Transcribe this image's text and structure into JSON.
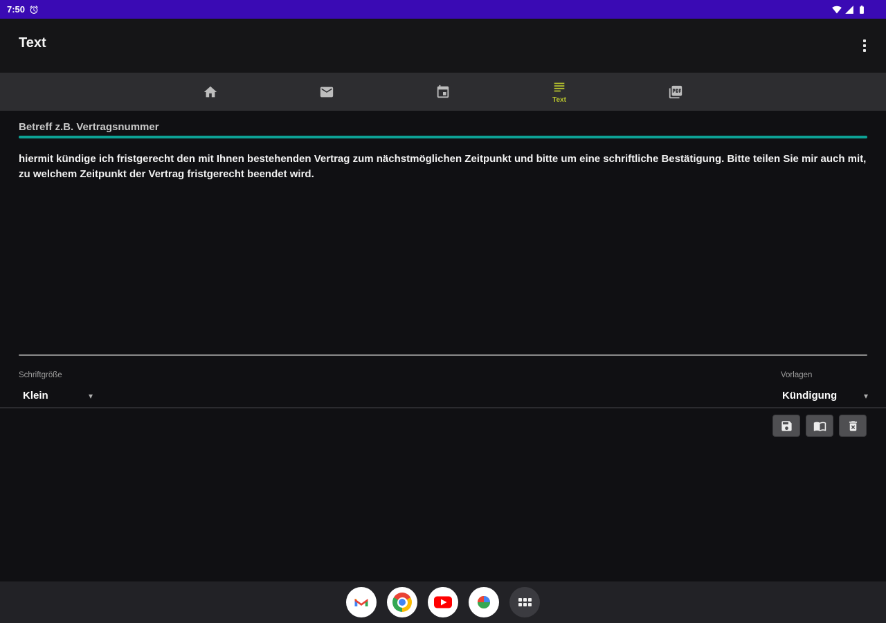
{
  "status_bar": {
    "time": "7:50",
    "icons": [
      "alarm-icon",
      "wifi-icon",
      "cellular-icon",
      "battery-icon"
    ]
  },
  "app_bar": {
    "title": "Text",
    "menu_icon": "kebab-menu-icon"
  },
  "tab_bar": {
    "tabs": [
      {
        "id": "home",
        "label": "",
        "active": false
      },
      {
        "id": "mail",
        "label": "",
        "active": false
      },
      {
        "id": "date",
        "label": "",
        "active": false
      },
      {
        "id": "text",
        "label": "Text",
        "active": true
      },
      {
        "id": "pdf",
        "label": "",
        "active": false
      }
    ]
  },
  "editor": {
    "subject_placeholder": "Betreff z.B. Vertragsnummer",
    "body": "hiermit kündige ich fristgerecht den mit Ihnen bestehenden Vertrag zum nächstmöglichen Zeitpunkt und bitte um eine schriftliche Bestätigung. Bitte teilen Sie mir auch mit, zu welchem Zeitpunkt der Vertrag fristgerecht beendet wird."
  },
  "controls": {
    "font_size": {
      "label": "Schriftgröße",
      "value": "Klein"
    },
    "templates": {
      "label": "Vorlagen",
      "value": "Kündigung"
    },
    "dropdown_arrow_glyph": "▾"
  },
  "action_buttons": [
    "save-icon",
    "book-icon",
    "delete-icon"
  ],
  "dock": {
    "apps": [
      "gmail",
      "chrome",
      "youtube",
      "photos"
    ],
    "all_apps": "app-drawer-button"
  },
  "colors": {
    "status_bar": "#3a0ab4",
    "accent_underline": "#0da295",
    "active_tab": "#b7c32e",
    "tab_bar_bg": "#2d2d30",
    "dock_bg": "#222226"
  }
}
